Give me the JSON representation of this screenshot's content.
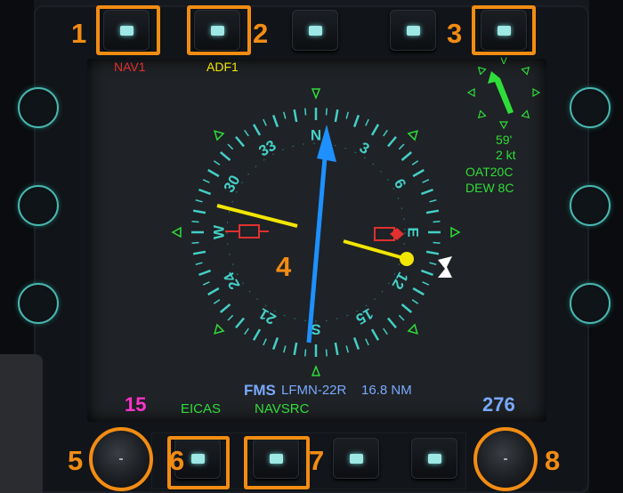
{
  "display": {
    "source_nav1": "NAV1",
    "source_adf1": "ADF1",
    "wind_altitude": "59'",
    "wind_speed": "2  kt",
    "oat": "OAT20C",
    "dew": "DEW  8C",
    "fms_label": "FMS",
    "fms_destination": "LFMN-22R",
    "fms_distance": "16.8  NM",
    "left_value": "15",
    "right_value": "276",
    "eicas_label": "EICAS",
    "navsrc_label": "NAVSRC"
  },
  "compass": {
    "heading_deg": 0,
    "cardinals": [
      "N",
      "E",
      "S",
      "W"
    ],
    "card_labels": [
      "3",
      "6",
      "12",
      "15",
      "21",
      "24",
      "30",
      "33"
    ],
    "course_arrow_deg": 4,
    "nav1_needle_deg": 72,
    "adf_needle_deg": -66
  },
  "callouts": [
    "1",
    "2",
    "3",
    "4",
    "5",
    "6",
    "7",
    "8"
  ],
  "colors": {
    "nav1": "#e03030",
    "adf1": "#f2e600",
    "compass": "#44cfc7",
    "course": "#1e90ff",
    "green": "#2fdd3a",
    "magenta": "#ff33cc",
    "fms_blue": "#79a9ff",
    "callout": "#f28c13"
  }
}
